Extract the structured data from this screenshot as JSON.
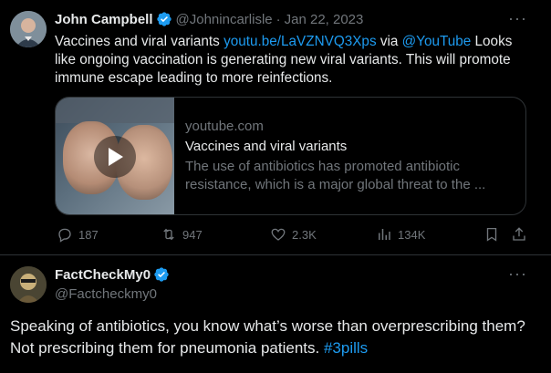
{
  "tweet1": {
    "name": "John Campbell",
    "handle": "@Johnincarlisle",
    "separator": "·",
    "date": "Jan 22, 2023",
    "more": "···",
    "text_before_link": "Vaccines and viral variants ",
    "link_url": "youtu.be/LaVZNVQ3Xps",
    "text_via": " via ",
    "mention": "@YouTube",
    "text_after": " Looks like ongoing vaccination is generating new viral variants. This will promote immune escape leading to more reinfections.",
    "card": {
      "domain": "youtube.com",
      "title": "Vaccines and viral variants",
      "description": "The use of antibiotics has promoted antibiotic resistance, which is a major global threat to the ..."
    },
    "actions": {
      "replies": "187",
      "retweets": "947",
      "likes": "2.3K",
      "views": "134K"
    }
  },
  "tweet2": {
    "name": "FactCheckMy0",
    "handle": "@Factcheckmy0",
    "more": "···",
    "text": "Speaking of antibiotics, you know what’s worse than overprescribing them? Not prescribing them for pneumonia patients. ",
    "hashtag": "#3pills"
  },
  "colors": {
    "background": "#000000",
    "text": "#e7e9ea",
    "muted": "#71767b",
    "link": "#1d9bf0",
    "verified": "#1d9bf0",
    "border": "#2f3336"
  }
}
